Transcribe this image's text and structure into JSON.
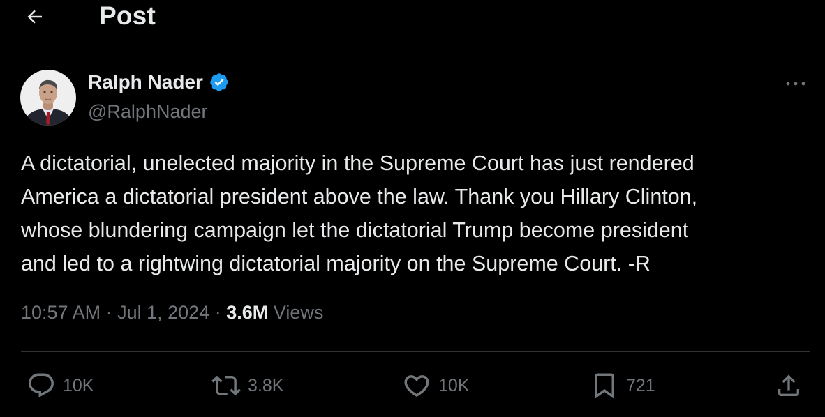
{
  "header": {
    "back_icon": "arrow-left-icon",
    "title": "Post"
  },
  "author": {
    "name": "Ralph Nader",
    "handle": "@RalphNader",
    "verified_icon": "verified-badge-icon",
    "verified_color": "#1d9bf0"
  },
  "post": {
    "lines": [
      "A dictatorial, unelected majority in the Supreme Court has just rendered",
      "America a dictatorial president above the law. Thank you Hillary Clinton,",
      "whose blundering campaign let the dictatorial Trump become president",
      "and led to a rightwing dictatorial majority on the Supreme Court. -R"
    ],
    "time": "10:57 AM",
    "separator": "·",
    "date": "Jul 1, 2024",
    "views_count": "3.6M",
    "views_label": "Views"
  },
  "actions": {
    "reply": {
      "icon": "reply-icon",
      "count": "10K"
    },
    "repost": {
      "icon": "repost-icon",
      "count": "3.8K"
    },
    "like": {
      "icon": "heart-icon",
      "count": "10K"
    },
    "bookmark": {
      "icon": "bookmark-icon",
      "count": "721"
    },
    "share": {
      "icon": "share-icon"
    }
  },
  "colors": {
    "background": "#000000",
    "text_primary": "#e7e9ea",
    "text_secondary": "#71767b",
    "divider": "#2f3336"
  }
}
